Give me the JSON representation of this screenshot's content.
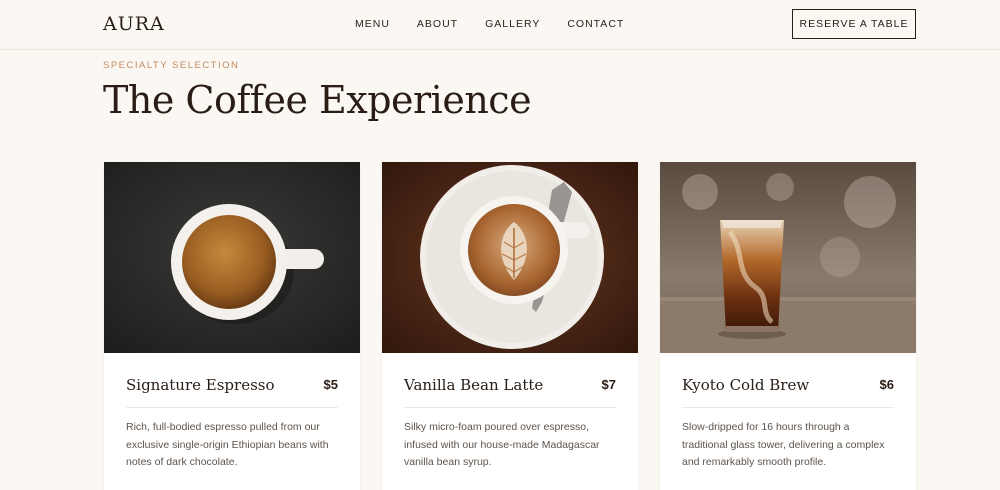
{
  "header": {
    "logo": "AURA",
    "nav": [
      "MENU",
      "ABOUT",
      "GALLERY",
      "CONTACT"
    ],
    "cta": "RESERVE A TABLE"
  },
  "hero": {
    "eyebrow": "SPECIALTY SELECTION",
    "title": "The Coffee Experience"
  },
  "products": [
    {
      "name": "Signature Espresso",
      "price": "$5",
      "description": "Rich, full-bodied espresso pulled from our exclusive single-origin Ethiopian beans with notes of dark chocolate."
    },
    {
      "name": "Vanilla Bean Latte",
      "price": "$7",
      "description": "Silky micro-foam poured over espresso, infused with our house-made Madagascar vanilla bean syrup."
    },
    {
      "name": "Kyoto Cold Brew",
      "price": "$6",
      "description": "Slow-dripped for 16 hours through a traditional glass tower, delivering a complex and remarkably smooth profile."
    }
  ],
  "colors": {
    "background": "#fbf8f4",
    "text": "#2a1d16",
    "accent": "#c08a5c"
  }
}
